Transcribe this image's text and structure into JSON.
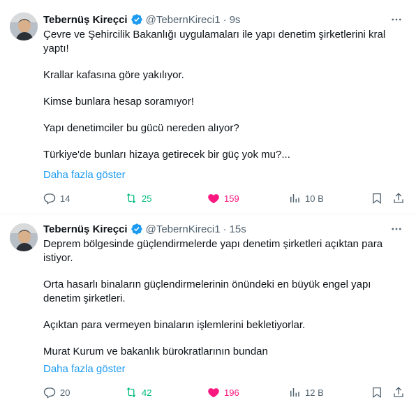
{
  "tweets": [
    {
      "author": {
        "name": "Tebernüş Kireçci",
        "handle": "@TebernKireci1",
        "time": "9s"
      },
      "lines": [
        "Çevre ve Şehircilik Bakanlığı uygulamaları ile yapı denetim şirketlerini kral",
        "yaptı!",
        "",
        "Krallar kafasına göre yakılıyor.",
        "",
        "Kimse bunlara hesap soramıyor!",
        "",
        "Yapı denetimciler bu gücü nereden alıyor?",
        "",
        "Türkiye'de bunları hizaya getirecek bir güç yok mu?..."
      ],
      "show_more": "Daha fazla göster",
      "stats": {
        "replies": "14",
        "retweets": "25",
        "likes": "159",
        "views": "10 B"
      }
    },
    {
      "author": {
        "name": "Tebernüş Kireçci",
        "handle": "@TebernKireci1",
        "time": "15s"
      },
      "lines": [
        "Deprem bölgesinde güçlendirmelerde yapı denetim şirketleri açıktan para",
        "istiyor.",
        "",
        "Orta hasarlı binaların güçlendirmelerinin önündeki en büyük engel yapı",
        "denetim şirketleri.",
        "",
        "Açıktan para vermeyen binaların işlemlerini bekletiyorlar.",
        "",
        "Murat Kurum ve bakanlık bürokratlarının bundan"
      ],
      "show_more": "Daha fazla göster",
      "stats": {
        "replies": "20",
        "retweets": "42",
        "likes": "196",
        "views": "12 B"
      }
    }
  ],
  "colors": {
    "accent": "#1d9bf0",
    "retweet": "#00ba7c",
    "like": "#f91880",
    "muted": "#536471",
    "text": "#0f1419"
  },
  "icons": [
    "verified-icon",
    "more-icon",
    "reply-icon",
    "retweet-icon",
    "like-icon",
    "views-icon",
    "bookmark-icon",
    "share-icon"
  ]
}
